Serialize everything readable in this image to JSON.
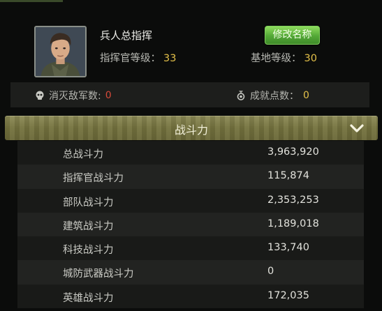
{
  "profile": {
    "name": "兵人总指挥",
    "rename_button": "修改名称",
    "commander_level_label": "指挥官等级：",
    "commander_level": "33",
    "base_level_label": "基地等级：",
    "base_level": "30"
  },
  "stats": {
    "kills_label": "消灭敌军数:",
    "kills_value": "0",
    "achievement_label": "成就点数：",
    "achievement_value": "0"
  },
  "power_section": {
    "title": "战斗力",
    "rows": [
      {
        "label": "总战斗力",
        "value": "3,963,920"
      },
      {
        "label": "指挥官战斗力",
        "value": "115,874"
      },
      {
        "label": "部队战斗力",
        "value": "2,353,253"
      },
      {
        "label": "建筑战斗力",
        "value": "1,189,018"
      },
      {
        "label": "科技战斗力",
        "value": "133,740"
      },
      {
        "label": "城防武器战斗力",
        "value": "0"
      },
      {
        "label": "英雄战斗力",
        "value": "172,035"
      }
    ]
  },
  "colors": {
    "accent_gold": "#e3c049",
    "kills_red": "#d64a3a",
    "button_green": "#53a836",
    "header_olive": "#75733f"
  },
  "icons": {
    "kills": "skull-icon",
    "achievement": "medal-icon",
    "collapse": "chevron-down-icon"
  }
}
